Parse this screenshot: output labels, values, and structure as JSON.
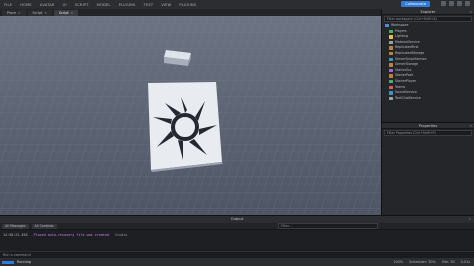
{
  "menubar": {
    "items": [
      "FILE",
      "HOME",
      "AVATAR",
      "UI",
      "SCRIPT",
      "MODEL",
      "PLUGINS",
      "TEST",
      "VIEW",
      "PLUGINS"
    ],
    "collaborate_label": "Collaborate"
  },
  "tabs": [
    {
      "label": "Place",
      "active": false
    },
    {
      "label": "Script",
      "active": false
    },
    {
      "label": "Script",
      "active": true
    }
  ],
  "explorer": {
    "title": "Explorer",
    "filter_placeholder": "Filter workspace (Ctrl+Shift+X)",
    "items": [
      {
        "label": "Workspace",
        "color": "#4a8ee0"
      },
      {
        "label": "Players",
        "color": "#3cba6b"
      },
      {
        "label": "Lighting",
        "color": "#e6c14a"
      },
      {
        "label": "MaterialService",
        "color": "#9aa3ad"
      },
      {
        "label": "ReplicatedFirst",
        "color": "#c07f3c"
      },
      {
        "label": "ReplicatedStorage",
        "color": "#c07f3c"
      },
      {
        "label": "ServerScriptService",
        "color": "#3c96c0"
      },
      {
        "label": "ServerStorage",
        "color": "#c07f3c"
      },
      {
        "label": "StarterGui",
        "color": "#9b6bd6"
      },
      {
        "label": "StarterPack",
        "color": "#c07f3c"
      },
      {
        "label": "StarterPlayer",
        "color": "#3cba6b"
      },
      {
        "label": "Teams",
        "color": "#e05a5a"
      },
      {
        "label": "SoundService",
        "color": "#3c96c0"
      },
      {
        "label": "TextChatService",
        "color": "#9aa3ad"
      }
    ]
  },
  "properties": {
    "title": "Properties",
    "filter_placeholder": "Filter Properties (Ctrl+Shift+P)"
  },
  "output": {
    "title": "Output",
    "buttons": [
      "All Messages",
      "All Contexts"
    ],
    "filter_placeholder": "Filter...",
    "log": {
      "time": "14:58:23.458",
      "message": "Placed auto-recovery file was created",
      "source": "Studio"
    }
  },
  "command_bar": {
    "placeholder": "Run a command"
  },
  "statusbar": {
    "left_label": "Running",
    "items": [
      "100%",
      "Scheduler: 30%",
      "Sim: 30",
      "0.01s"
    ]
  }
}
